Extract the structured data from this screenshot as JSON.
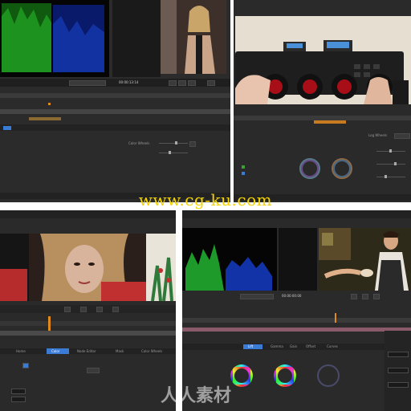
{
  "colors": {
    "panel_bg": "#2b2b2b",
    "accent_orange": "#e08a1e",
    "accent_blue": "#3a7bd5",
    "watermark_yellow": "#f5d400"
  },
  "watermark": {
    "url": "www.cg-ku.com",
    "brand_cn": "人人素材"
  },
  "q1": {
    "timecode": "00:00:13:14",
    "tabs": [
      "Color",
      "Primaries",
      "Curves"
    ],
    "label_wheels": "Color Wheels"
  },
  "q2": {
    "label": "Log Wheels"
  },
  "q3": {
    "timecode": "00:00:21:08",
    "tabs": [
      "Home",
      "Color",
      "Node Editor",
      "Mask",
      "Color Wheels"
    ]
  },
  "q4": {
    "timecode": "00:00:00:00",
    "tabs": [
      "Lift",
      "Gamma",
      "Gain",
      "Offset",
      "Curves"
    ]
  }
}
